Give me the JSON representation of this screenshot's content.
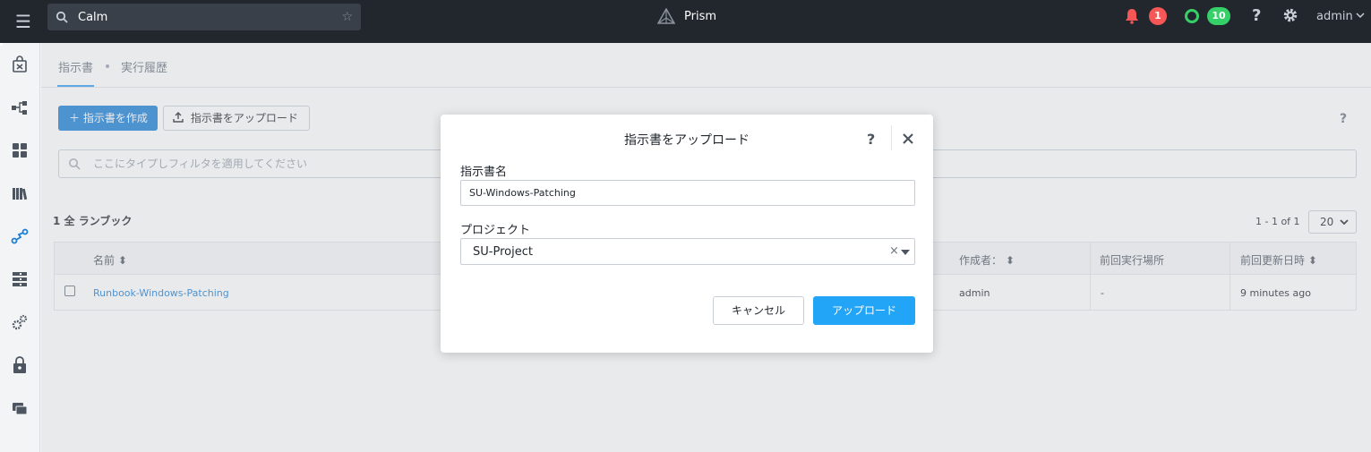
{
  "topbar": {
    "search_value": "Calm",
    "brand": "Prism",
    "alert_count": "1",
    "task_count": "10",
    "user": "admin"
  },
  "tabs": [
    {
      "label": "指示書",
      "active": true
    },
    {
      "label": "実行履歴",
      "active": false
    }
  ],
  "toolbar": {
    "create_label": "指示書を作成",
    "upload_label": "指示書をアップロード",
    "help": "?"
  },
  "filter": {
    "placeholder": "ここにタイプしフィルタを適用してください"
  },
  "list": {
    "count_label": "1 全 ランブック",
    "pager": "1 - 1 of 1",
    "per_page": "20",
    "columns": [
      "名前 ⬍",
      "作成者： ⬍",
      "前回実行場所",
      "前回更新日時 ⬍"
    ],
    "rows": [
      {
        "name": "Runbook-Windows-Patching",
        "creator": "admin",
        "last_run": "-",
        "updated": "9 minutes ago"
      }
    ]
  },
  "modal": {
    "title": "指示書をアップロード",
    "help": "?",
    "name_label": "指示書名",
    "name_value": "SU-Windows-Patching",
    "project_label": "プロジェクト",
    "project_value": "SU-Project",
    "clear": "×",
    "cancel_label": "キャンセル",
    "upload_label": "アップロード"
  },
  "colors": {
    "topbar": "#22272e",
    "primary": "#1b7fd6",
    "upload_button": "#22a5f7",
    "alert": "#f55656",
    "success": "#36d068"
  }
}
